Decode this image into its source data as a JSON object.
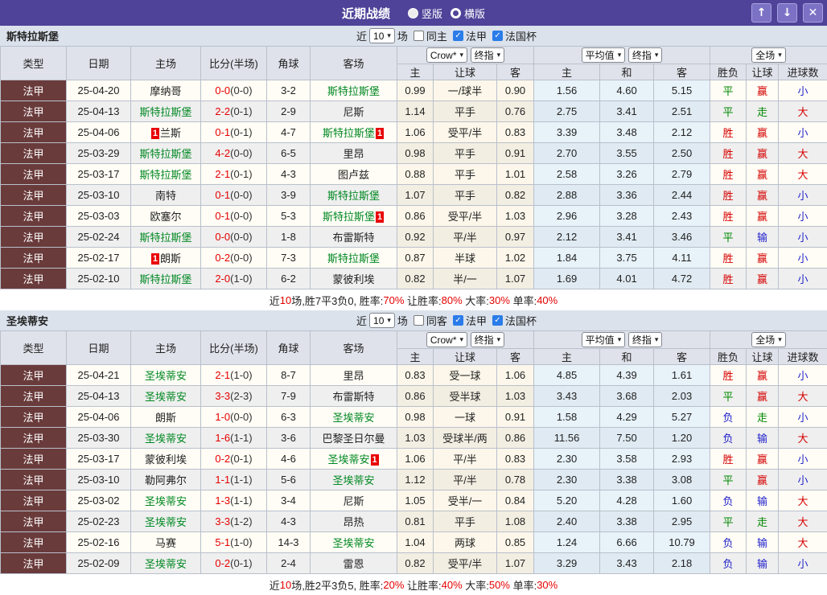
{
  "title_bar": {
    "title": "近期战绩",
    "radio_vertical": "竖版",
    "radio_horizontal": "横版"
  },
  "icons": {
    "check": "✓",
    "chevron_down": "▾",
    "up_arrow": "↑",
    "down_arrow": "↓",
    "close": "✕"
  },
  "colors": {
    "header_purple": "#4e4399",
    "button_purple": "#7b72c6",
    "league_cell_maroon": "#6a3b3b",
    "team_green": "#008822",
    "score_red": "#e60000",
    "checkbox_blue": "#2b7ce9"
  },
  "result_colors": {
    "胜": "#d60000",
    "平": "#008800",
    "负": "#2222cc",
    "赢": "#d60000",
    "走": "#008800",
    "输": "#2222cc",
    "大": "#d60000",
    "小": "#2222cc"
  },
  "table_header": {
    "type": "类型",
    "date": "日期",
    "home": "主场",
    "score": "比分(半场)",
    "corner": "角球",
    "away": "客场",
    "sub": [
      "主",
      "让球",
      "客",
      "主",
      "和",
      "客",
      "胜负",
      "让球",
      "进球数"
    ],
    "selects": {
      "company": "Crow*",
      "stage1": "终指",
      "avg": "平均值",
      "stage2": "终指",
      "scope": "全场"
    }
  },
  "sections": [
    {
      "team": "斯特拉斯堡",
      "filter": {
        "near_label": "近",
        "count": "10",
        "games_label": "场",
        "same_label": "同主",
        "league1": "法甲",
        "league2": "法国杯"
      },
      "rows": [
        {
          "lg": "法甲",
          "dt": "25-04-20",
          "hm": "摩纳哥",
          "hmG": false,
          "hmC": "",
          "sc": "0-0",
          "hf": "(0-0)",
          "cn": "3-2",
          "aw": "斯特拉斯堡",
          "awG": true,
          "awC": "",
          "o1": "0.99",
          "hc": "一/球半",
          "o2": "0.90",
          "a1": "1.56",
          "a2": "4.60",
          "a3": "5.15",
          "r1": "平",
          "r2": "赢",
          "r3": "小"
        },
        {
          "lg": "法甲",
          "dt": "25-04-13",
          "hm": "斯特拉斯堡",
          "hmG": true,
          "hmC": "",
          "sc": "2-2",
          "hf": "(0-1)",
          "cn": "2-9",
          "aw": "尼斯",
          "awG": false,
          "awC": "",
          "o1": "1.14",
          "hc": "平手",
          "o2": "0.76",
          "a1": "2.75",
          "a2": "3.41",
          "a3": "2.51",
          "r1": "平",
          "r2": "走",
          "r3": "大"
        },
        {
          "lg": "法甲",
          "dt": "25-04-06",
          "hm": "兰斯",
          "hmG": false,
          "hmC": "1",
          "sc": "0-1",
          "hf": "(0-1)",
          "cn": "4-7",
          "aw": "斯特拉斯堡",
          "awG": true,
          "awC": "1",
          "o1": "1.06",
          "hc": "受平/半",
          "o2": "0.83",
          "a1": "3.39",
          "a2": "3.48",
          "a3": "2.12",
          "r1": "胜",
          "r2": "赢",
          "r3": "小"
        },
        {
          "lg": "法甲",
          "dt": "25-03-29",
          "hm": "斯特拉斯堡",
          "hmG": true,
          "hmC": "",
          "sc": "4-2",
          "hf": "(0-0)",
          "cn": "6-5",
          "aw": "里昂",
          "awG": false,
          "awC": "",
          "o1": "0.98",
          "hc": "平手",
          "o2": "0.91",
          "a1": "2.70",
          "a2": "3.55",
          "a3": "2.50",
          "r1": "胜",
          "r2": "赢",
          "r3": "大"
        },
        {
          "lg": "法甲",
          "dt": "25-03-17",
          "hm": "斯特拉斯堡",
          "hmG": true,
          "hmC": "",
          "sc": "2-1",
          "hf": "(0-1)",
          "cn": "4-3",
          "aw": "图卢兹",
          "awG": false,
          "awC": "",
          "o1": "0.88",
          "hc": "平手",
          "o2": "1.01",
          "a1": "2.58",
          "a2": "3.26",
          "a3": "2.79",
          "r1": "胜",
          "r2": "赢",
          "r3": "大"
        },
        {
          "lg": "法甲",
          "dt": "25-03-10",
          "hm": "南特",
          "hmG": false,
          "hmC": "",
          "sc": "0-1",
          "hf": "(0-0)",
          "cn": "3-9",
          "aw": "斯特拉斯堡",
          "awG": true,
          "awC": "",
          "o1": "1.07",
          "hc": "平手",
          "o2": "0.82",
          "a1": "2.88",
          "a2": "3.36",
          "a3": "2.44",
          "r1": "胜",
          "r2": "赢",
          "r3": "小"
        },
        {
          "lg": "法甲",
          "dt": "25-03-03",
          "hm": "欧塞尔",
          "hmG": false,
          "hmC": "",
          "sc": "0-1",
          "hf": "(0-0)",
          "cn": "5-3",
          "aw": "斯特拉斯堡",
          "awG": true,
          "awC": "1",
          "o1": "0.86",
          "hc": "受平/半",
          "o2": "1.03",
          "a1": "2.96",
          "a2": "3.28",
          "a3": "2.43",
          "r1": "胜",
          "r2": "赢",
          "r3": "小"
        },
        {
          "lg": "法甲",
          "dt": "25-02-24",
          "hm": "斯特拉斯堡",
          "hmG": true,
          "hmC": "",
          "sc": "0-0",
          "hf": "(0-0)",
          "cn": "1-8",
          "aw": "布雷斯特",
          "awG": false,
          "awC": "",
          "o1": "0.92",
          "hc": "平/半",
          "o2": "0.97",
          "a1": "2.12",
          "a2": "3.41",
          "a3": "3.46",
          "r1": "平",
          "r2": "输",
          "r3": "小"
        },
        {
          "lg": "法甲",
          "dt": "25-02-17",
          "hm": "朗斯",
          "hmG": false,
          "hmC": "1",
          "sc": "0-2",
          "hf": "(0-0)",
          "cn": "7-3",
          "aw": "斯特拉斯堡",
          "awG": true,
          "awC": "",
          "o1": "0.87",
          "hc": "半球",
          "o2": "1.02",
          "a1": "1.84",
          "a2": "3.75",
          "a3": "4.11",
          "r1": "胜",
          "r2": "赢",
          "r3": "小"
        },
        {
          "lg": "法甲",
          "dt": "25-02-10",
          "hm": "斯特拉斯堡",
          "hmG": true,
          "hmC": "",
          "sc": "2-0",
          "hf": "(1-0)",
          "cn": "6-2",
          "aw": "蒙彼利埃",
          "awG": false,
          "awC": "",
          "o1": "0.82",
          "hc": "半/一",
          "o2": "1.07",
          "a1": "1.69",
          "a2": "4.01",
          "a3": "4.72",
          "r1": "胜",
          "r2": "赢",
          "r3": "小"
        }
      ],
      "summary": [
        {
          "text": "近",
          "red": false
        },
        {
          "text": "10",
          "red": true
        },
        {
          "text": "场,胜7平3负0, 胜率:",
          "red": false
        },
        {
          "text": "70%",
          "red": true
        },
        {
          "text": " 让胜率:",
          "red": false
        },
        {
          "text": "80%",
          "red": true
        },
        {
          "text": " 大率:",
          "red": false
        },
        {
          "text": "30%",
          "red": true
        },
        {
          "text": " 单率:",
          "red": false
        },
        {
          "text": "40%",
          "red": true
        }
      ]
    },
    {
      "team": "圣埃蒂安",
      "filter": {
        "near_label": "近",
        "count": "10",
        "games_label": "场",
        "same_label": "同客",
        "league1": "法甲",
        "league2": "法国杯"
      },
      "rows": [
        {
          "lg": "法甲",
          "dt": "25-04-21",
          "hm": "圣埃蒂安",
          "hmG": true,
          "hmC": "",
          "sc": "2-1",
          "hf": "(1-0)",
          "cn": "8-7",
          "aw": "里昂",
          "awG": false,
          "awC": "",
          "o1": "0.83",
          "hc": "受一球",
          "o2": "1.06",
          "a1": "4.85",
          "a2": "4.39",
          "a3": "1.61",
          "r1": "胜",
          "r2": "赢",
          "r3": "小"
        },
        {
          "lg": "法甲",
          "dt": "25-04-13",
          "hm": "圣埃蒂安",
          "hmG": true,
          "hmC": "",
          "sc": "3-3",
          "hf": "(2-3)",
          "cn": "7-9",
          "aw": "布雷斯特",
          "awG": false,
          "awC": "",
          "o1": "0.86",
          "hc": "受半球",
          "o2": "1.03",
          "a1": "3.43",
          "a2": "3.68",
          "a3": "2.03",
          "r1": "平",
          "r2": "赢",
          "r3": "大"
        },
        {
          "lg": "法甲",
          "dt": "25-04-06",
          "hm": "朗斯",
          "hmG": false,
          "hmC": "",
          "sc": "1-0",
          "hf": "(0-0)",
          "cn": "6-3",
          "aw": "圣埃蒂安",
          "awG": true,
          "awC": "",
          "o1": "0.98",
          "hc": "一球",
          "o2": "0.91",
          "a1": "1.58",
          "a2": "4.29",
          "a3": "5.27",
          "r1": "负",
          "r2": "走",
          "r3": "小"
        },
        {
          "lg": "法甲",
          "dt": "25-03-30",
          "hm": "圣埃蒂安",
          "hmG": true,
          "hmC": "",
          "sc": "1-6",
          "hf": "(1-1)",
          "cn": "3-6",
          "aw": "巴黎圣日尔曼",
          "awG": false,
          "awC": "",
          "o1": "1.03",
          "hc": "受球半/两",
          "o2": "0.86",
          "a1": "11.56",
          "a2": "7.50",
          "a3": "1.20",
          "r1": "负",
          "r2": "输",
          "r3": "大"
        },
        {
          "lg": "法甲",
          "dt": "25-03-17",
          "hm": "蒙彼利埃",
          "hmG": false,
          "hmC": "",
          "sc": "0-2",
          "hf": "(0-1)",
          "cn": "4-6",
          "aw": "圣埃蒂安",
          "awG": true,
          "awC": "1",
          "o1": "1.06",
          "hc": "平/半",
          "o2": "0.83",
          "a1": "2.30",
          "a2": "3.58",
          "a3": "2.93",
          "r1": "胜",
          "r2": "赢",
          "r3": "小"
        },
        {
          "lg": "法甲",
          "dt": "25-03-10",
          "hm": "勒阿弗尔",
          "hmG": false,
          "hmC": "",
          "sc": "1-1",
          "hf": "(1-1)",
          "cn": "5-6",
          "aw": "圣埃蒂安",
          "awG": true,
          "awC": "",
          "o1": "1.12",
          "hc": "平/半",
          "o2": "0.78",
          "a1": "2.30",
          "a2": "3.38",
          "a3": "3.08",
          "r1": "平",
          "r2": "赢",
          "r3": "小"
        },
        {
          "lg": "法甲",
          "dt": "25-03-02",
          "hm": "圣埃蒂安",
          "hmG": true,
          "hmC": "",
          "sc": "1-3",
          "hf": "(1-1)",
          "cn": "3-4",
          "aw": "尼斯",
          "awG": false,
          "awC": "",
          "o1": "1.05",
          "hc": "受半/一",
          "o2": "0.84",
          "a1": "5.20",
          "a2": "4.28",
          "a3": "1.60",
          "r1": "负",
          "r2": "输",
          "r3": "大"
        },
        {
          "lg": "法甲",
          "dt": "25-02-23",
          "hm": "圣埃蒂安",
          "hmG": true,
          "hmC": "",
          "sc": "3-3",
          "hf": "(1-2)",
          "cn": "4-3",
          "aw": "昂热",
          "awG": false,
          "awC": "",
          "o1": "0.81",
          "hc": "平手",
          "o2": "1.08",
          "a1": "2.40",
          "a2": "3.38",
          "a3": "2.95",
          "r1": "平",
          "r2": "走",
          "r3": "大"
        },
        {
          "lg": "法甲",
          "dt": "25-02-16",
          "hm": "马赛",
          "hmG": false,
          "hmC": "",
          "sc": "5-1",
          "hf": "(1-0)",
          "cn": "14-3",
          "aw": "圣埃蒂安",
          "awG": true,
          "awC": "",
          "o1": "1.04",
          "hc": "两球",
          "o2": "0.85",
          "a1": "1.24",
          "a2": "6.66",
          "a3": "10.79",
          "r1": "负",
          "r2": "输",
          "r3": "大"
        },
        {
          "lg": "法甲",
          "dt": "25-02-09",
          "hm": "圣埃蒂安",
          "hmG": true,
          "hmC": "",
          "sc": "0-2",
          "hf": "(0-1)",
          "cn": "2-4",
          "aw": "雷恩",
          "awG": false,
          "awC": "",
          "o1": "0.82",
          "hc": "受平/半",
          "o2": "1.07",
          "a1": "3.29",
          "a2": "3.43",
          "a3": "2.18",
          "r1": "负",
          "r2": "输",
          "r3": "小"
        }
      ],
      "summary": [
        {
          "text": "近",
          "red": false
        },
        {
          "text": "10",
          "red": true
        },
        {
          "text": "场,胜2平3负5, 胜率:",
          "red": false
        },
        {
          "text": "20%",
          "red": true
        },
        {
          "text": " 让胜率:",
          "red": false
        },
        {
          "text": "40%",
          "red": true
        },
        {
          "text": " 大率:",
          "red": false
        },
        {
          "text": "50%",
          "red": true
        },
        {
          "text": " 单率:",
          "red": false
        },
        {
          "text": "30%",
          "red": true
        }
      ]
    }
  ]
}
